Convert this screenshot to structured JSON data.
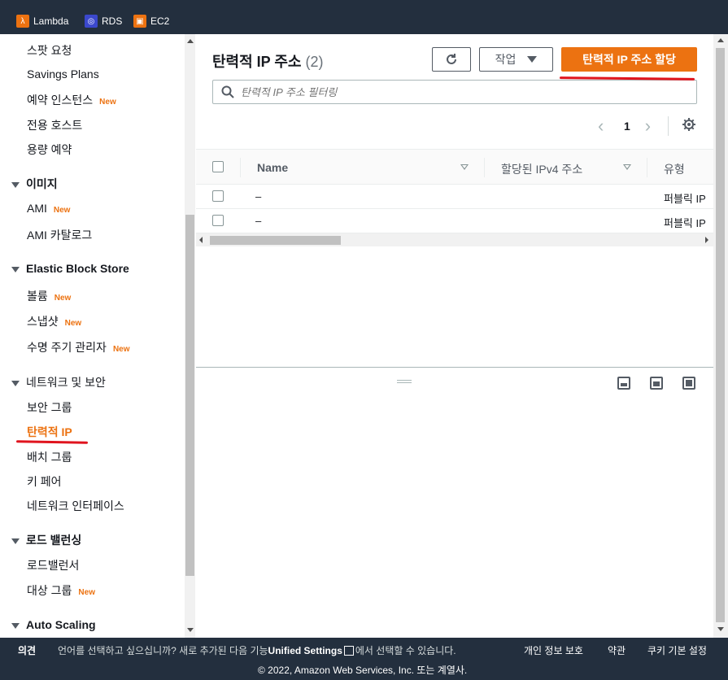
{
  "topbar": {
    "favorites": [
      {
        "label": "Lambda",
        "icon": "lambda-icon",
        "color": "#ec7211"
      },
      {
        "label": "RDS",
        "icon": "rds-icon",
        "color": "#3b48cc"
      },
      {
        "label": "EC2",
        "icon": "ec2-icon",
        "color": "#ec7211"
      }
    ]
  },
  "sidebar": {
    "items_top": [
      "스팟 요청",
      "Savings Plans",
      "예약 인스턴스",
      "전용 호스트",
      "용량 예약"
    ],
    "new_badge": "New",
    "sections": {
      "images": {
        "title": "이미지",
        "items": [
          "AMI",
          "AMI 카탈로그"
        ]
      },
      "ebs": {
        "title": "Elastic Block Store",
        "items": [
          "볼륨",
          "스냅샷",
          "수명 주기 관리자"
        ]
      },
      "network": {
        "title": "네트워크 및 보안",
        "items": [
          "보안 그룹",
          "탄력적 IP",
          "배치 그룹",
          "키 페어",
          "네트워크 인터페이스"
        ]
      },
      "lb": {
        "title": "로드 밸런싱",
        "items": [
          "로드밸런서",
          "대상 그룹"
        ]
      },
      "autoscaling": {
        "title": "Auto Scaling"
      }
    }
  },
  "main": {
    "title": "탄력적 IP 주소",
    "count": "(2)",
    "actions_label": "작업",
    "allocate_label": "탄력적 IP 주소 할당",
    "search_placeholder": "탄력적 IP 주소 필터링",
    "page": "1",
    "columns": [
      "Name",
      "할당된 IPv4 주소",
      "유형"
    ],
    "rows": [
      {
        "name": "–",
        "ip": "",
        "type": "퍼블릭 IP"
      },
      {
        "name": "–",
        "ip": "",
        "type": "퍼블릭 IP"
      }
    ]
  },
  "footer": {
    "feedback": "의견",
    "language_text_1": "언어를 선택하고 싶으십니까? 새로 추가된 다음 기능",
    "unified_settings": "Unified Settings",
    "language_text_2": "에서 선택할 수 있습니다.",
    "privacy": "개인 정보 보호",
    "terms": "약관",
    "cookies": "쿠키 기본 설정",
    "copyright": "© 2022, Amazon Web Services, Inc. 또는 계열사."
  },
  "colors": {
    "accent": "#ec7211",
    "header": "#232f3e",
    "annotation": "#e0141e"
  }
}
